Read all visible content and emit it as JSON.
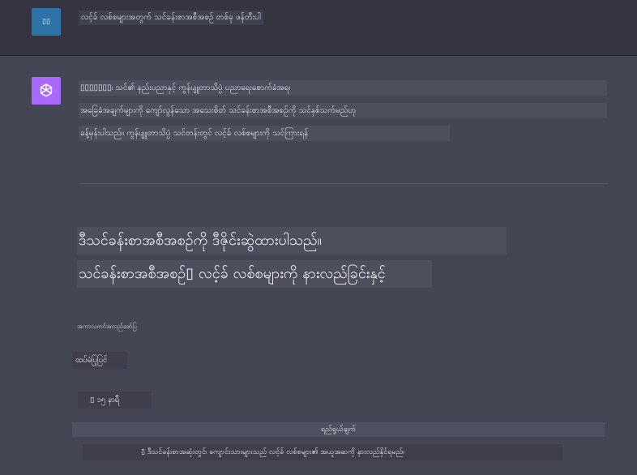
{
  "user": {
    "avatar_text": "▯▯",
    "message": "လင့်ခ် လစ်စများအတွက် သင်ခန်းစာအစီအစဉ် တစ်ခု ဖန်တီးပါ"
  },
  "assistant": {
    "intro_lines": [
      "▯▯▯▯▯▯▯၊ သင်၏ နည်းပညာနှင့် ကွန်ပျူတာသိပ္ပံ ပညာရေးစောက်ခံအရ၊",
      "အခြေခံအချက်များကို ကျော်လွန်သော အသေးစိတ် သင်ခန်းစာအစီအစဉ်ကို သင်နှစ်သက်မည်ဟု",
      "ခန့်မှန်းပါသည်။ ကွန်ပျူတာသိပ္ပံ သင်တန်းတွင် လင့်ခ် လစ်စများကို သင်ကြားရန်"
    ],
    "title_lines": [
      "ဒီသင်ခန်းစာအစီအစဉ်ကို ဒီဇိုင်းဆွဲထားပါသည်။",
      "သင်ခန်းစာအစီအစဉ်▯ လင့်ခ် လစ်စများကို နားလည်ခြင်းနှင့်"
    ],
    "subheading": "အကာလတင်အလည်ဖော်ပြ",
    "level_chip": "ထပ်မံပြုပြင်",
    "duration_chip": "▯ ၁၅ နာရီ",
    "table": {
      "header": "ရည်ရွယ်ချက်",
      "row": "▯ ဒီသင်ခန်းစာအဆုံးတွင်၊ ကျောင်းသားများသည် လင့်ခ် လစ်စများ၏ အယူအဆကို နားလည်နိုင်ရမည်၊"
    }
  },
  "colors": {
    "user_bg": "#343541",
    "assistant_bg": "#444654",
    "user_avatar": "#2e73a8",
    "bot_avatar": "#ab68ff"
  }
}
